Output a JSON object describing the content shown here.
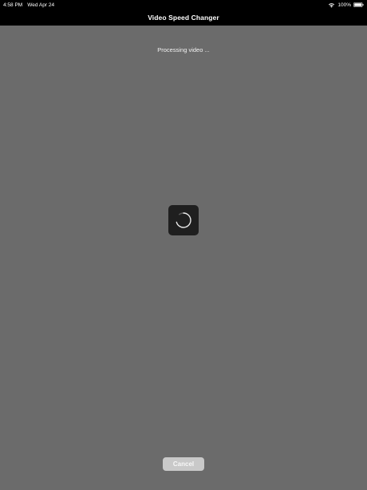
{
  "status_bar": {
    "time": "4:58 PM",
    "date": "Wed Apr 24",
    "battery": "100%",
    "wifi_icon": "wifi-icon",
    "battery_icon": "battery-icon"
  },
  "nav_bar": {
    "title": "Video Speed Changer"
  },
  "main": {
    "processing_text": "Processing video ...",
    "spinner_icon": "loading-spinner-icon",
    "cancel_label": "Cancel"
  },
  "colors": {
    "background": "#6b6b6b",
    "bars": "#000000",
    "spinner_box": "#1f1f1f",
    "cancel_button": "#c9c9c9"
  }
}
